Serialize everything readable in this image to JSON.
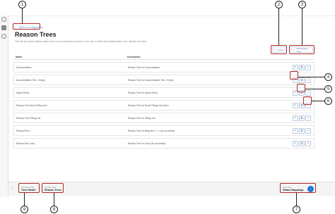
{
  "header": {
    "back_label": "Back to configuration",
    "title": "Reason Trees",
    "subtitle": "This lets you build multiple reason trees for your machines and these to be able to reflect all possible states of the machine and time.",
    "import_label": "Import",
    "add_label": "Add Reason Tree"
  },
  "table": {
    "columns": [
      "Name",
      "Description"
    ],
    "rows": [
      {
        "name": "Documentation",
        "desc": "Reason Tree for Documentation"
      },
      {
        "name": "Documentation Tree - Empty",
        "desc": "Reason Tree for Documentation Tree - Empty"
      },
      {
        "name": "Import Demo",
        "desc": "Reason Tree for Import Demo"
      },
      {
        "name": "Reason Tree Demo Filling Line",
        "desc": "Reason Tree for Demo Filling Line Demo"
      },
      {
        "name": "Reason Tree Filling Line",
        "desc": "Reason Tree for Filling Line"
      },
      {
        "name": "ReasonTree 1",
        "desc": "Reason Tree for filling line 1 > 1 (do not delete)"
      },
      {
        "name": "ReasonTree Line1",
        "desc": "Reason Tree for Line1 (do not delete)"
      }
    ]
  },
  "footer": {
    "prev_caption": "Previous step",
    "prev_label": "Time Model",
    "current_caption": "Current step",
    "current_label": "Reason Trees",
    "next_caption": "Next step",
    "next_label": "Status Mappings"
  },
  "callouts": [
    "1",
    "2",
    "3",
    "4",
    "5",
    "6",
    "7",
    "8",
    "9"
  ],
  "colors": {
    "accent": "#1e74d6",
    "highlight": "#b22a2a"
  }
}
